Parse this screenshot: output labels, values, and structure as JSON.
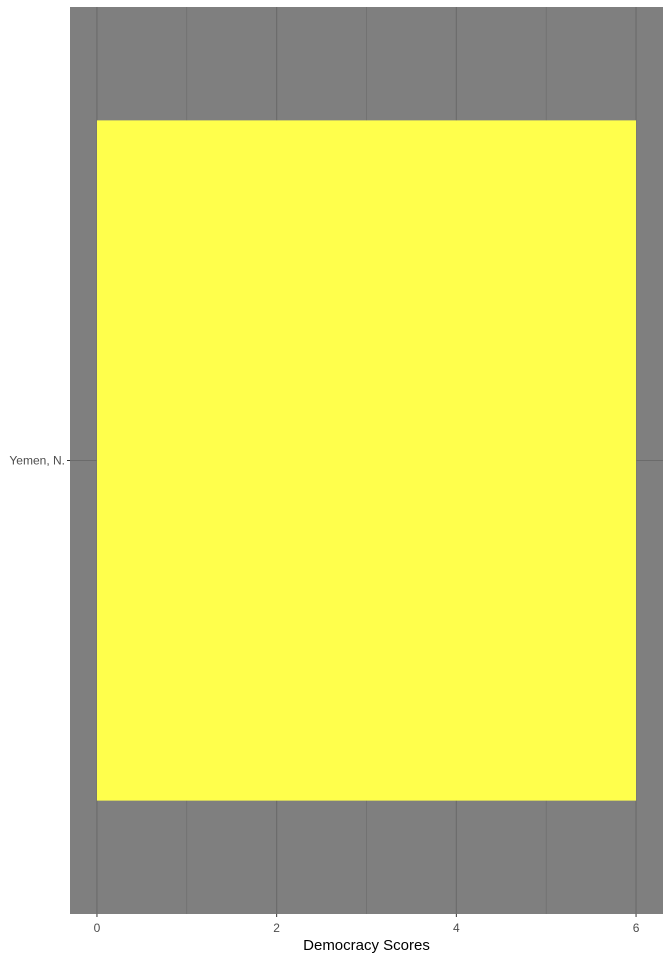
{
  "chart_data": {
    "type": "bar",
    "orientation": "horizontal",
    "categories": [
      "Yemen, N."
    ],
    "values": [
      6
    ],
    "xlabel": "Democracy Scores",
    "ylabel": "",
    "xlim": [
      -0.3,
      6.3
    ],
    "x_ticks": [
      0,
      2,
      4,
      6
    ],
    "x_minor_ticks": [
      1,
      3,
      5
    ],
    "grid": true,
    "panel_color": "#7F7F7F",
    "grid_color": "#6B6B6B",
    "bar_color": "#FFFF4C",
    "tick_label_color": "#4D4D4D",
    "axis_title_color": "#000000"
  }
}
